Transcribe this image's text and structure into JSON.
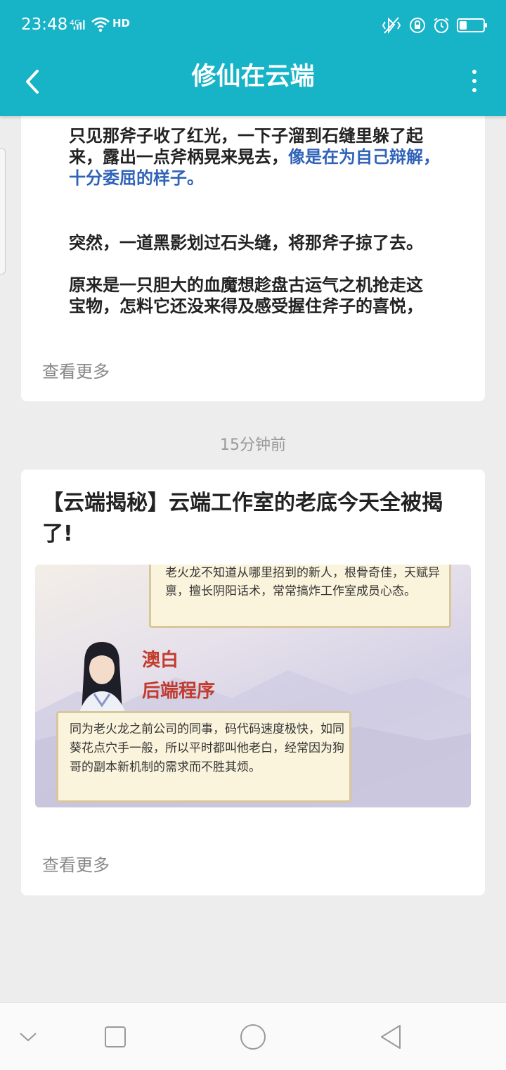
{
  "status_bar": {
    "time": "23:48",
    "network": "4G",
    "hd": "HD"
  },
  "header": {
    "title": "修仙在云端"
  },
  "card1": {
    "lines": [
      "只见那斧子收了红光，一下子溜到石缝里躲了起",
      "来，露出一点斧柄晃来晃去，",
      "像是在为自己辩解，",
      "十分委屈的样子。",
      "突然，一道黑影划过石头缝，将那斧子掠了去。",
      "原来是一只胆大的血魔想趁盘古运气之机抢走这",
      "宝物，怎料它还没来得及感受握住斧子的喜悦，"
    ],
    "see_more": "查看更多"
  },
  "timestamp": "15分钟前",
  "card2": {
    "title": "【云端揭秘】云端工作室的老底今天全被揭了!",
    "image": {
      "scroll1_text": "老火龙不知道从哪里招到的新人，根骨奇佳，天赋异禀，擅长阴阳话术，常常搞炸工作室成员心态。",
      "name": "澳白",
      "role": "后端程序",
      "scroll2_text": "同为老火龙之前公司的同事，码代码速度极快，如同葵花点穴手一般，所以平时都叫他老白，经常因为狗哥的副本新机制的需求而不胜其烦。"
    },
    "see_more": "查看更多"
  },
  "colors": {
    "header_bg": "#17b3c7",
    "page_bg": "#ededed",
    "link_blue": "#2f62b8"
  }
}
